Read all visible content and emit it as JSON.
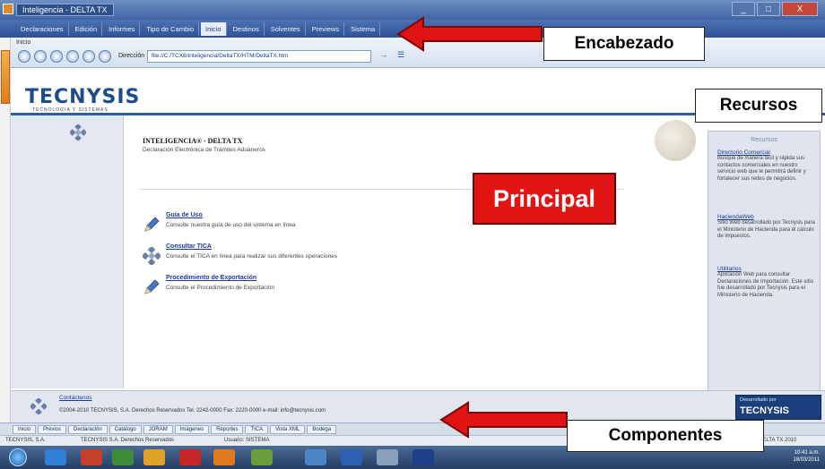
{
  "window": {
    "title": "Inteligencia - DELTA TX",
    "controls": [
      "_",
      "□",
      "X"
    ]
  },
  "menubar": {
    "items": [
      {
        "label": "Declaraciones"
      },
      {
        "label": "Edición"
      },
      {
        "label": "Informes"
      },
      {
        "label": "Tipo de Cambio"
      },
      {
        "label": "Inicio",
        "active": true
      },
      {
        "label": "Destinos"
      },
      {
        "label": "Solventes"
      },
      {
        "label": "Previews"
      },
      {
        "label": "Sistema"
      }
    ]
  },
  "toolbar": {
    "inicio_label": "Inicio",
    "direccion_label": "Dirección",
    "address_value": "file://C:/TCX8/Inteligencia/DeltaTX/HTM/DeltaTX.htm",
    "go_label": "→",
    "fav_label": "☰"
  },
  "header": {
    "logo": "TECNYSIS",
    "logo_sub": "TECNOLOGIA Y SISTEMAS"
  },
  "main": {
    "heading": "INTELIGENCIA® - DELTA TX",
    "subheading": "Declaración Electrónica de Trámites Aduaneros",
    "links": [
      {
        "title": "Guía de Uso",
        "desc": "Consulte nuestra guía de uso del sistema en línea",
        "icon": "pencil-icon"
      },
      {
        "title": "Consultar TICA",
        "desc": "Consulte el TICA en línea para realizar sus diferentes operaciones",
        "icon": "tecnysis-diamond-icon"
      },
      {
        "title": "Procedimiento de Exportación",
        "desc": "Consulte el Procedimiento de Exportación",
        "icon": "pencil-icon"
      }
    ]
  },
  "resources": {
    "heading": "Recursos",
    "items": [
      {
        "title": "Directorio Comercial",
        "desc": "Busque de manera fácil y rápida sus contactos comerciales en nuestro servicio web que le permitirá definir y fortalecer sus redes de negocios."
      },
      {
        "title": "HaciendaWeb",
        "desc": "Sitio Web desarrollado por Tecnysis para el Ministerio de Hacienda para el cálculo de impuestos."
      },
      {
        "title": "Utilitarios",
        "desc": "Aplicación Web para consultar Declaraciones de Importación. Este sitio fue desarrollado por Tecnysis para el Ministerio de Hacienda."
      }
    ]
  },
  "footer": {
    "link": "Contáctenos",
    "text": "©2004-2010 TECNYSIS, S.A. Derechos Reservados   Tel. 2242-0000   Fax: 2220-0000   e-mail: info@tecnysis.com",
    "badge_small": "Desarrollado por",
    "badge_logo": "TECNYSIS"
  },
  "component_tabs": [
    {
      "label": "Inicio"
    },
    {
      "label": "Previos"
    },
    {
      "label": "Declaración"
    },
    {
      "label": "Catálogo"
    },
    {
      "label": "JORAM"
    },
    {
      "label": "Imágenes"
    },
    {
      "label": "Reportes"
    },
    {
      "label": "TICA"
    },
    {
      "label": "Vista XML"
    },
    {
      "label": "Bodega"
    }
  ],
  "statusbar": {
    "left": "TECNYSIS, S.A.",
    "middle": "TECNYSIS S.A. Derechos Reservados",
    "user": "Usuario: SISTEMA",
    "right": "DELTA TX 2010"
  },
  "taskbar": {
    "clock_time": "10:41 a.m.",
    "clock_date": "18/03/2011"
  },
  "annotations": {
    "encabezado": "Encabezado",
    "recursos": "Recursos",
    "principal": "Principal",
    "componentes": "Componentes"
  },
  "colors": {
    "accent_blue": "#2c5ea6",
    "annotation_red": "#e11414"
  }
}
